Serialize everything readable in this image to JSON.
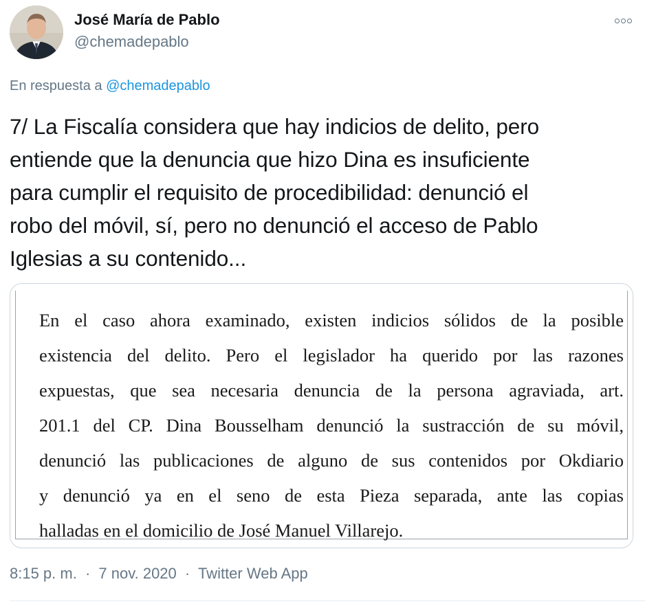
{
  "author": {
    "display_name": "José María de Pablo",
    "handle": "@chemadepablo",
    "avatar_icon": "person-portrait-avatar"
  },
  "reply_context": {
    "prefix": "En respuesta a",
    "mention": "@chemadepablo"
  },
  "tweet": {
    "lines": [
      "7/ La Fiscalía considera que hay indicios de delito, pero",
      "entiende que la denuncia que hizo Dina es insuficiente",
      "para cumplir el requisito de procedibilidad: denunció el",
      "robo del móvil, sí, pero no denunció el acceso de Pablo",
      "Iglesias a su contenido..."
    ]
  },
  "document_image": {
    "lines": [
      "En el caso ahora examinado, existen indicios sólidos de la posible",
      "existencia del delito. Pero el legislador ha querido por las razones",
      "expuestas, que sea necesaria denuncia de la persona agraviada, art.",
      "201.1 del CP. Dina Bousselham denunció la sustracción de su móvil,",
      "denunció las publicaciones de alguno de sus contenidos por Okdiario",
      "y denunció ya en el seno de esta Pieza separada, ante las copias",
      "halladas en el domicilio de José Manuel Villarejo."
    ]
  },
  "meta": {
    "time": "8:15 p. m.",
    "separator": "·",
    "date": "7 nov. 2020",
    "source": "Twitter Web App"
  },
  "icons": {
    "more": "more-options-icon"
  },
  "colors": {
    "text_primary": "#14171a",
    "text_secondary": "#657786",
    "link": "#1b95e0",
    "border": "#ccd6dd"
  }
}
